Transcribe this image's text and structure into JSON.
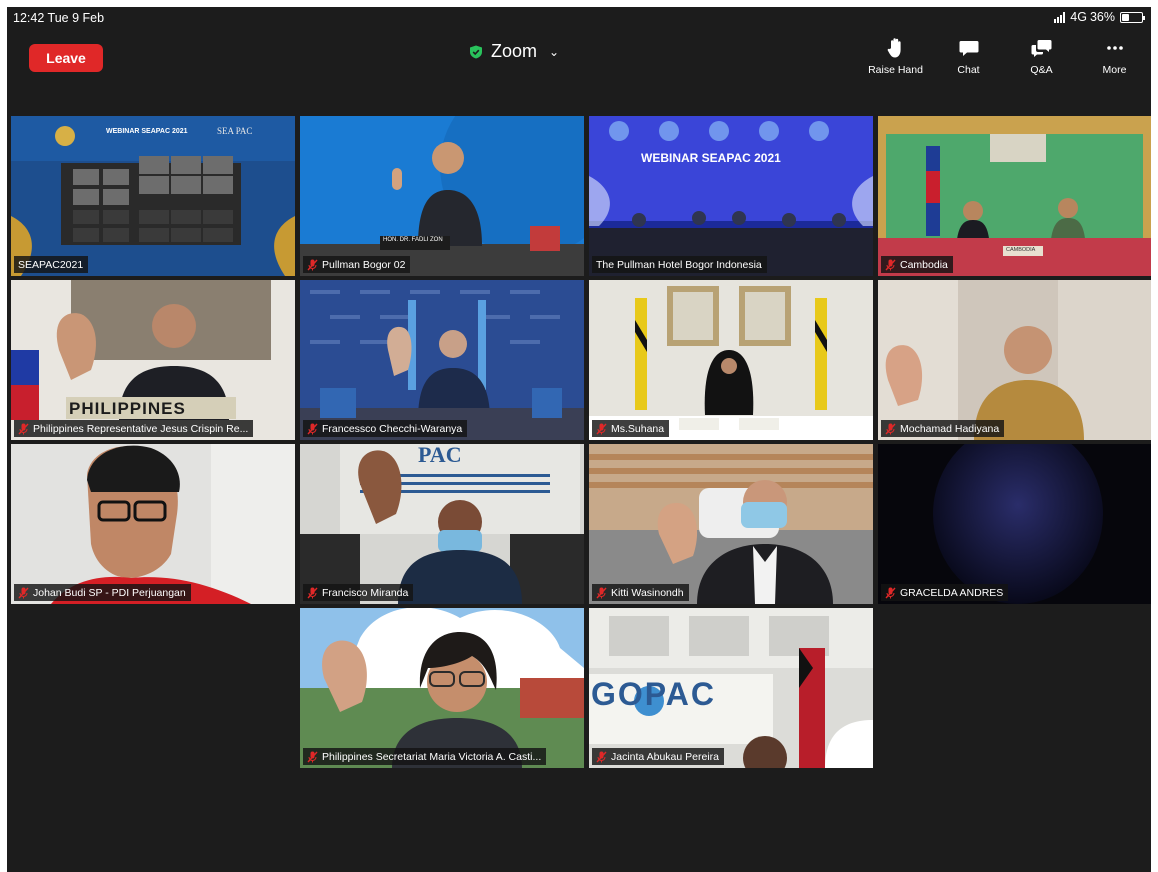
{
  "status_bar": {
    "time": "12:42  Tue 9 Feb",
    "network": "4G",
    "battery": "36%",
    "battery_level": 0.36
  },
  "header": {
    "leave_label": "Leave",
    "app_title": "Zoom",
    "actions": [
      {
        "label": "Raise Hand",
        "icon": "raise-hand-icon"
      },
      {
        "label": "Chat",
        "icon": "chat-icon"
      },
      {
        "label": "Q&A",
        "icon": "qa-icon"
      },
      {
        "label": "More",
        "icon": "more-icon"
      }
    ]
  },
  "colors": {
    "leave": "#e02828",
    "active_speaker": "#29c35c",
    "muted": "#e02828",
    "background": "#1c1c1c"
  },
  "participants": [
    {
      "name": "SEAPAC2021",
      "muted": false,
      "banner_title": "WEBINAR SEAPAC 2021",
      "banner_logo": "SEA PAC"
    },
    {
      "name": "Pullman Bogor 02",
      "muted": true,
      "nameplate": "HON. DR. FADLI ZON"
    },
    {
      "name": "The Pullman Hotel Bogor Indonesia",
      "muted": false,
      "active": true,
      "banner_title": "WEBINAR SEAPAC 2021"
    },
    {
      "name": "Cambodia",
      "muted": true,
      "nameplate": "CAMBODIA"
    },
    {
      "name": "Philippines Representative Jesus Crispin Re...",
      "muted": true,
      "nameplate": "PHILIPPINES"
    },
    {
      "name": "Francessco Checchi-Waranya",
      "muted": true
    },
    {
      "name": "Ms.Suhana",
      "muted": true
    },
    {
      "name": "Mochamad Hadiyana",
      "muted": true
    },
    {
      "name": "Johan Budi SP - PDI Perjuangan",
      "muted": true
    },
    {
      "name": "Francisco Miranda",
      "muted": true,
      "backdrop_text": "PAC"
    },
    {
      "name": "Kitti Wasinondh",
      "muted": true
    },
    {
      "name": "GRACELDA ANDRES",
      "muted": true
    },
    {
      "name": "Philippines Secretariat Maria Victoria A. Casti...",
      "muted": true
    },
    {
      "name": "Jacinta Abukau Pereira",
      "muted": true,
      "backdrop_text": "GOPAC"
    }
  ]
}
